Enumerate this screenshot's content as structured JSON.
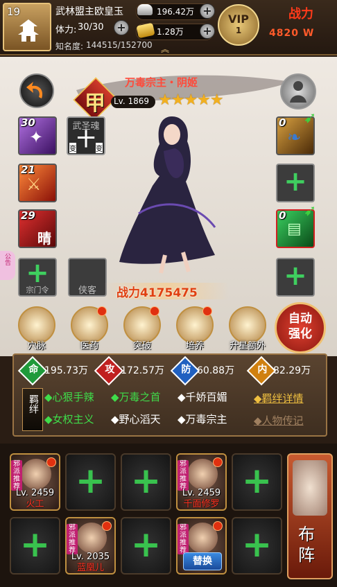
{
  "header": {
    "level": "19",
    "player_name": "武林盟主欧皇玉",
    "stamina_label": "体力:",
    "stamina_value": "30/30",
    "fame_label": "知名度:",
    "fame_value": "144515/152700",
    "silver": "196.42万",
    "gold": "1.28万",
    "vip_label": "VIP",
    "vip_level": "1",
    "power_label": "战力",
    "power_value": "4820 W"
  },
  "hero": {
    "name": "万毒宗主・阴姬",
    "grade": "甲",
    "level": "Lv. 1869",
    "stars": 5,
    "combat_power": "战力4175475"
  },
  "equipment": {
    "left": [
      {
        "count": "30",
        "color": "#7a2ab0"
      },
      {
        "caption": "武圣魂",
        "tag_left": "变",
        "tag_right": "变"
      },
      {
        "count": "21",
        "color": "#c02a10"
      },
      {
        "count": "29",
        "color": "#b01818",
        "char": "晴"
      },
      {
        "caption": "宗门令"
      }
    ],
    "right": [
      {
        "count": "0"
      },
      {},
      {
        "count": "0"
      },
      {}
    ],
    "mid_caption": "侠客"
  },
  "side_tag": "公告",
  "menu": [
    {
      "label": "穴脉",
      "icon": "meridian-icon",
      "dot": false
    },
    {
      "label": "医药",
      "icon": "medicine-icon",
      "dot": true
    },
    {
      "label": "突破",
      "icon": "breakthrough-icon",
      "dot": true
    },
    {
      "label": "培养",
      "icon": "cultivate-icon",
      "dot": true
    },
    {
      "label": "升星额外",
      "icon": "star-up-icon",
      "dot": false
    }
  ],
  "auto_button": {
    "line1": "自动",
    "line2": "强化"
  },
  "stats": [
    {
      "badge": "命",
      "value": "195.73万",
      "color": "#1f9a3a"
    },
    {
      "badge": "攻",
      "value": "172.57万",
      "color": "#c02020"
    },
    {
      "badge": "防",
      "value": "60.88万",
      "color": "#2060c0"
    },
    {
      "badge": "内",
      "value": "82.29万",
      "color": "#d08010"
    }
  ],
  "fetters": {
    "label": "羁绊",
    "row1": [
      {
        "text": "◆心狠手辣",
        "active": true
      },
      {
        "text": "◆万毒之首",
        "active": true
      },
      {
        "text": "◆千娇百媚",
        "active": false
      }
    ],
    "row2": [
      {
        "text": "◆女权主义",
        "active": true
      },
      {
        "text": "◆野心滔天",
        "active": false
      },
      {
        "text": "◆万毒宗主",
        "active": false
      }
    ],
    "detail_link": "◆羁绊详情",
    "bio_link": "◆人物传记"
  },
  "formation": {
    "slots": [
      {
        "filled": true,
        "level": "Lv. 2459",
        "name": "火工",
        "sect": "邪派推荐"
      },
      {
        "filled": false
      },
      {
        "filled": false
      },
      {
        "filled": true,
        "level": "Lv. 2459",
        "name": "千面修罗",
        "sect": "邪派推荐"
      },
      {
        "filled": false
      },
      {
        "filled": false
      },
      {
        "filled": true,
        "level": "Lv. 2035",
        "name": "蓝凰儿",
        "sect": "邪派推荐"
      },
      {
        "filled": false
      },
      {
        "filled": true,
        "sect": "邪派推荐",
        "swap": "替换"
      },
      {
        "filled": false
      }
    ],
    "deploy_label": "布阵"
  }
}
